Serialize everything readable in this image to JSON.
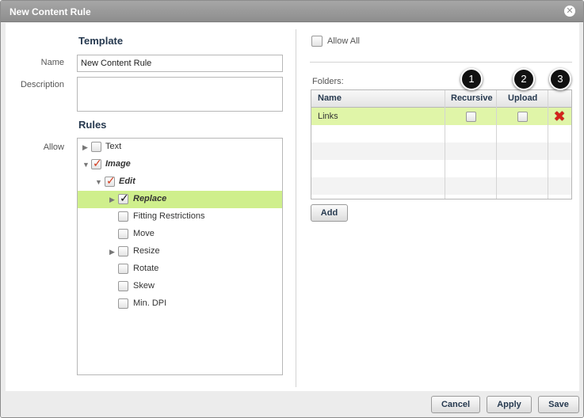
{
  "dialog": {
    "title": "New Content Rule",
    "close_glyph": "✕"
  },
  "template": {
    "section_title": "Template",
    "name_label": "Name",
    "name_value": "New Content Rule",
    "description_label": "Description",
    "description_value": ""
  },
  "rules": {
    "section_title": "Rules",
    "allow_label": "Allow",
    "tree": [
      {
        "label": "Text",
        "checked": false,
        "expandable": true,
        "expanded": false
      },
      {
        "label": "Image",
        "checked": true,
        "expandable": true,
        "expanded": true
      },
      {
        "label": "Edit",
        "checked": true,
        "expandable": true,
        "expanded": true
      },
      {
        "label": "Replace",
        "checked": true,
        "expandable": true,
        "expanded": false,
        "selected": true
      },
      {
        "label": "Fitting Restrictions",
        "checked": false,
        "expandable": false
      },
      {
        "label": "Move",
        "checked": false,
        "expandable": false
      },
      {
        "label": "Resize",
        "checked": false,
        "expandable": true,
        "expanded": false
      },
      {
        "label": "Rotate",
        "checked": false,
        "expandable": false
      },
      {
        "label": "Skew",
        "checked": false,
        "expandable": false
      },
      {
        "label": "Min. DPI",
        "checked": false,
        "expandable": false
      }
    ]
  },
  "folders": {
    "allow_all_label": "Allow All",
    "allow_all_checked": false,
    "folders_label": "Folders:",
    "columns": {
      "name": "Name",
      "recursive": "Recursive",
      "upload": "Upload"
    },
    "rows": [
      {
        "name": "Links",
        "recursive": false,
        "upload": false
      }
    ],
    "add_label": "Add",
    "badges": [
      "1",
      "2",
      "3"
    ]
  },
  "footer": {
    "cancel_label": "Cancel",
    "apply_label": "Apply",
    "save_label": "Save"
  },
  "icons": {
    "expand_collapsed": "▶",
    "expand_open": "▼",
    "delete": "✖"
  },
  "colors": {
    "titlebar": "#9a9a9a",
    "selected_row": "#cfef8c",
    "heading": "#26394f",
    "delete": "#d4231a"
  }
}
